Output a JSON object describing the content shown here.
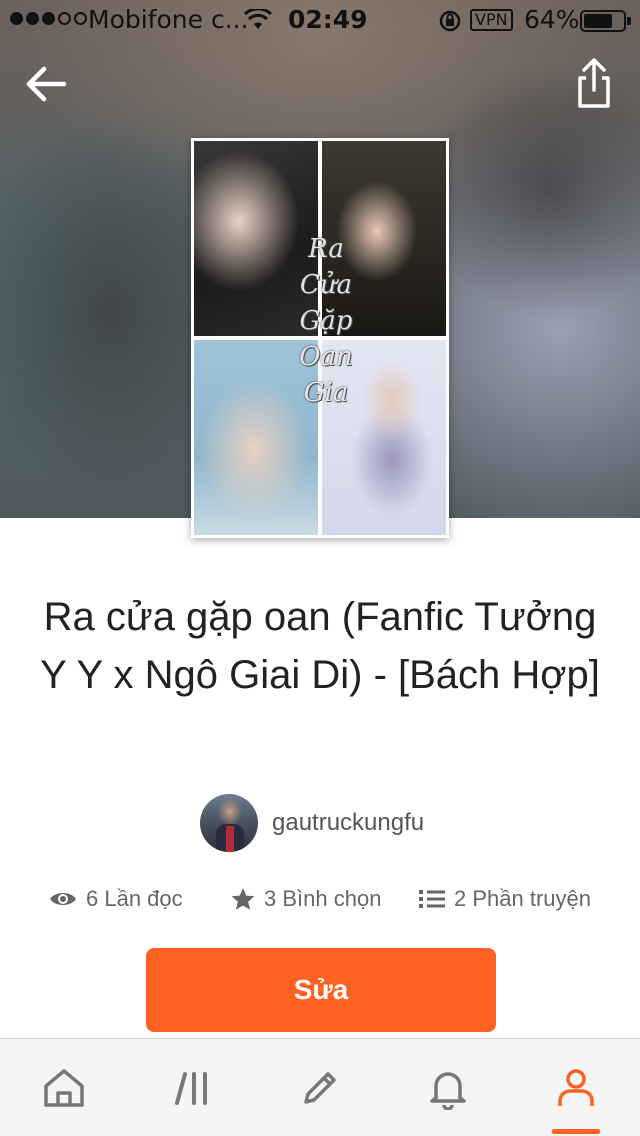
{
  "status_bar": {
    "carrier": "Mobifone c...",
    "time": "02:49",
    "vpn": "VPN",
    "battery": "64%"
  },
  "header": {
    "back_icon": "arrow-left-icon",
    "share_icon": "share-icon"
  },
  "cover": {
    "title_lines": [
      "Ra",
      "Cửa",
      "Gặp",
      "Oan",
      "Gia"
    ]
  },
  "story": {
    "title": "Ra cửa gặp oan (Fanfic Tưởng Y Y x Ngô Giai Di) - [Bách Hợp]",
    "author": "gautruckungfu"
  },
  "stats": {
    "reads": "6 Lần đọc",
    "votes": "3 Bình chọn",
    "parts": "2 Phần truyện"
  },
  "actions": {
    "edit_label": "Sửa"
  },
  "tab_bar": {
    "items": [
      "home-icon",
      "library-icon",
      "pencil-icon",
      "bell-icon",
      "profile-icon"
    ],
    "active": "profile",
    "accent": "#ff6122"
  }
}
